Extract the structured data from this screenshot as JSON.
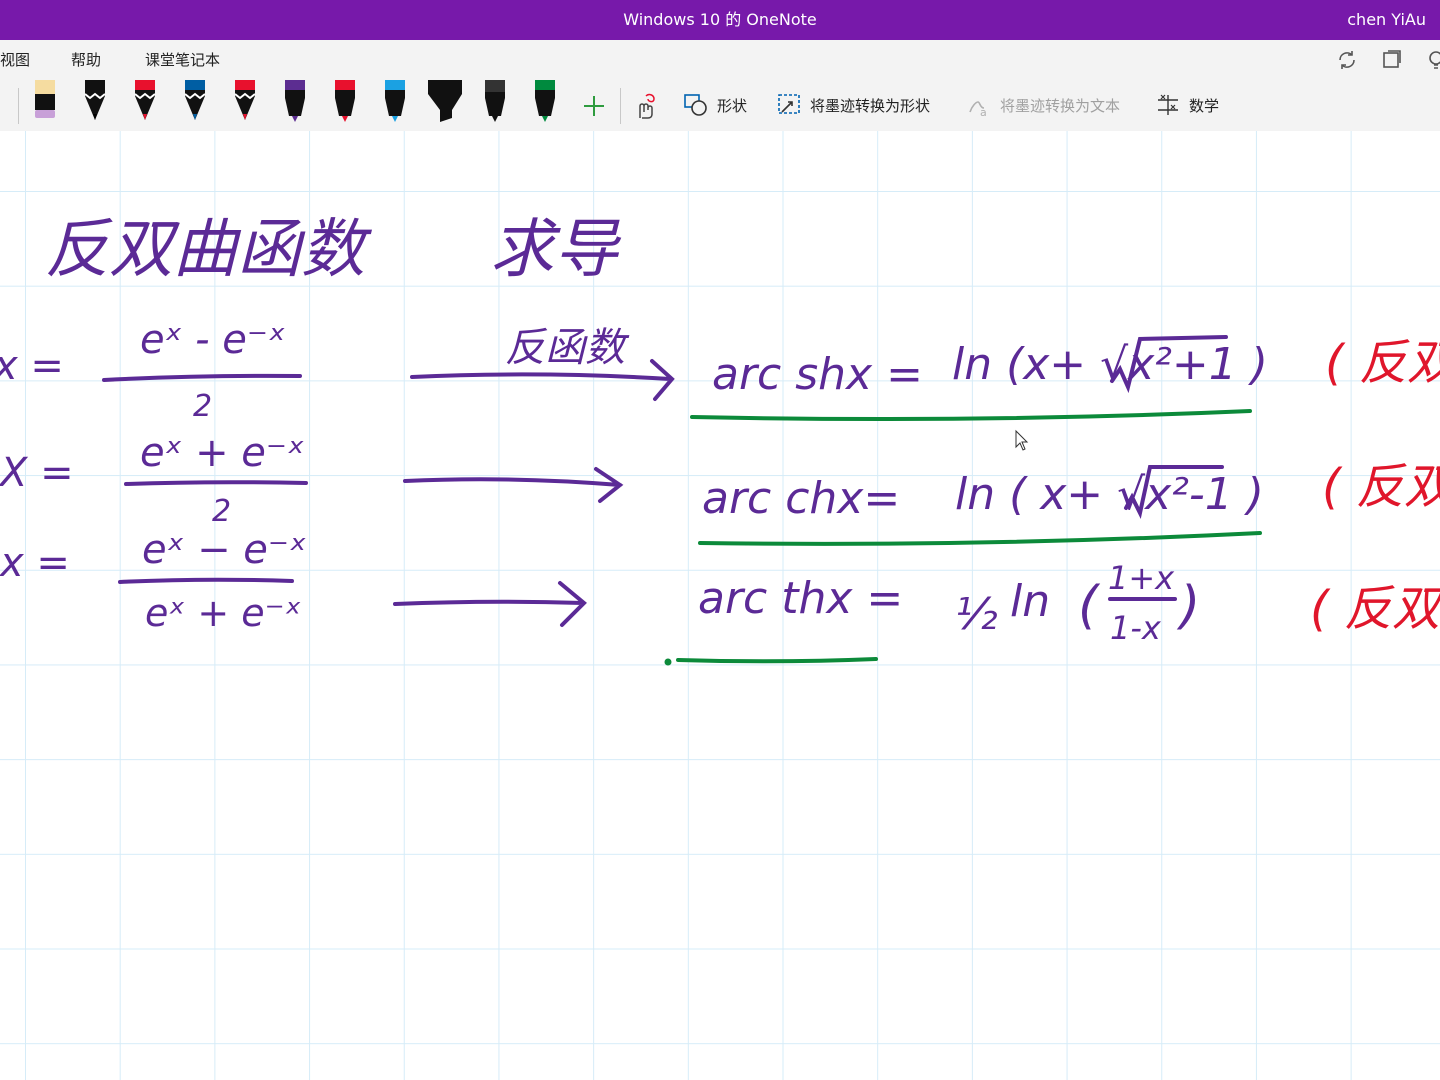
{
  "window": {
    "title": "Windows 10 的 OneNote",
    "user": "chen YiAu"
  },
  "menu": {
    "items": [
      "视图",
      "帮助",
      "课堂笔记本"
    ]
  },
  "toolbar": {
    "add_pen_icon": "plus-icon",
    "pens": [
      {
        "name": "eraser-pen",
        "color": "#c8a0d8"
      },
      {
        "name": "black-pen",
        "color": "#000000"
      },
      {
        "name": "red-pen",
        "color": "#e8112d"
      },
      {
        "name": "blue-pen",
        "color": "#005ea3"
      },
      {
        "name": "red-pen-2",
        "color": "#e8112d"
      },
      {
        "name": "purple-pen",
        "color": "#5c2d91"
      },
      {
        "name": "red-pen-3",
        "color": "#e8112d"
      },
      {
        "name": "cyan-pen",
        "color": "#1ba1e2"
      },
      {
        "name": "black-highlighter",
        "color": "#000000"
      },
      {
        "name": "black-pen-2",
        "color": "#000000"
      },
      {
        "name": "green-pen",
        "color": "#008a3e"
      }
    ],
    "tools": {
      "shapes": "形状",
      "ink_to_shape": "将墨迹转换为形状",
      "ink_to_text": "将墨迹转换为文本",
      "math": "数学"
    }
  },
  "ink_colors": {
    "purple": "#5b2a96",
    "green": "#0c8a3a",
    "red": "#e0162b"
  },
  "note": {
    "heading": "反双曲函数",
    "heading_tail": "求导",
    "arrow_label": "反函数",
    "left": {
      "row1": {
        "lhs": "x =",
        "numerator": "eˣ - e⁻ˣ",
        "denominator": "2"
      },
      "row2": {
        "lhs": "X =",
        "numerator": "eˣ + e⁻ˣ",
        "denominator": "2"
      },
      "row3": {
        "lhs": "x =",
        "numerator": "eˣ − e⁻ˣ",
        "denominator": "eˣ + e⁻ˣ"
      }
    },
    "right": {
      "row1": {
        "lhs": "arc shx =",
        "rhs": "ln (x+ √x²+1 )"
      },
      "row2": {
        "lhs": "arc chx=",
        "rhs": "ln ( x+ √x²-1 )"
      },
      "row3": {
        "lhs": "arc thx =",
        "coef": "½",
        "fn": "ln",
        "num": "1+x",
        "den": "1-x"
      }
    },
    "remarks": [
      "( 反双",
      "( 反双",
      "( 反双"
    ]
  }
}
